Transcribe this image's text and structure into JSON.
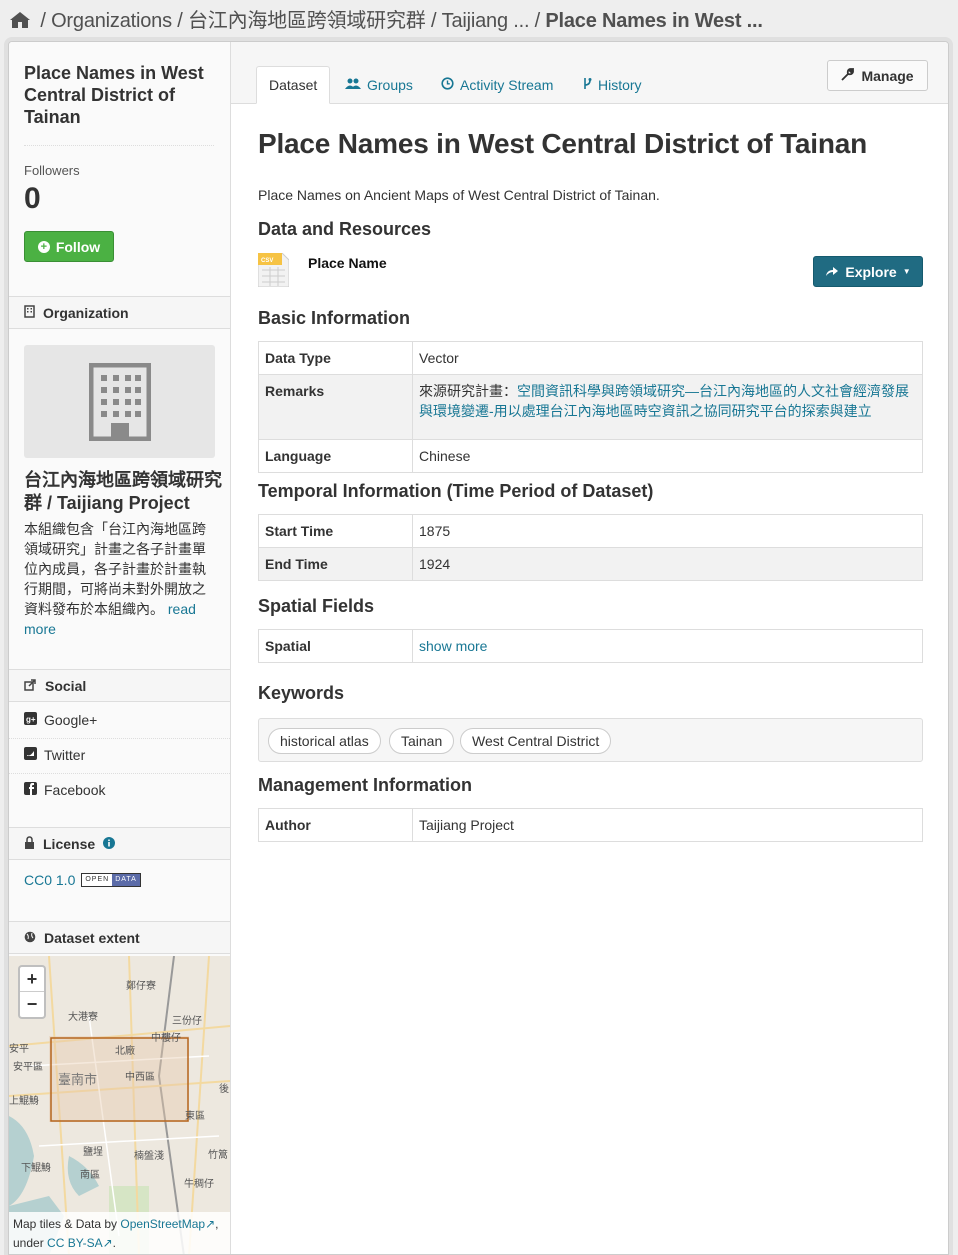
{
  "breadcrumb": {
    "home_icon": "home-icon",
    "sep": "/",
    "items": [
      "Organizations",
      "台江內海地區跨領域研究群",
      "Taijiang ...",
      "Place Names in West ..."
    ]
  },
  "sidebar": {
    "title": "Place Names in West Central District of Tainan",
    "followers_label": "Followers",
    "followers_count": "0",
    "follow_button": "Follow",
    "organization_heading": "Organization",
    "org_name": "台江內海地區跨領域研究群 / Taijiang Project",
    "org_description": "本組織包含「台江內海地區跨領域研究」計畫之各子計畫單位內成員，各子計畫於計畫執行期間，可將尚未對外開放之資料發布於本組織內。",
    "read_more": "read more",
    "social_heading": "Social",
    "social_items": [
      "Google+",
      "Twitter",
      "Facebook"
    ],
    "license_heading": "License",
    "license_link": "CC0 1.0",
    "open_data_badge": [
      "OPEN",
      "DATA"
    ],
    "extent_heading": "Dataset extent",
    "map": {
      "zoom_in": "+",
      "zoom_out": "−",
      "labels": [
        "鄭仔寮",
        "大港寮",
        "三份仔",
        "中樓仔",
        "安平",
        "北廠",
        "安平區",
        "臺南市",
        "中西區",
        "後",
        "上鯤鯓",
        "東區",
        "鹽埕",
        "竹篙",
        "楠盤淺",
        "下鯤鯓",
        "南區",
        "牛稠仔"
      ],
      "attribution_prefix": "Map tiles & Data by ",
      "attribution_osm": "OpenStreetMap",
      "attribution_mid": ",",
      "attribution_under": "under ",
      "attribution_license": "CC BY-SA",
      "attribution_end": "."
    }
  },
  "tabs": {
    "items": [
      {
        "label": "Dataset",
        "icon": ""
      },
      {
        "label": "Groups",
        "icon": "users-icon"
      },
      {
        "label": "Activity Stream",
        "icon": "clock-icon"
      },
      {
        "label": "History",
        "icon": "branch-icon"
      }
    ],
    "manage_button": "Manage"
  },
  "dataset": {
    "title": "Place Names in West Central District of Tainan",
    "notes": "Place Names on Ancient Maps of West Central District of Tainan.",
    "resources_heading": "Data and Resources",
    "resource": {
      "format": "CSV",
      "name": "Place Name"
    },
    "explore_button": "Explore",
    "basic_heading": "Basic Information",
    "basic_rows": {
      "data_type_label": "Data Type",
      "data_type_value": "Vector",
      "remarks_label": "Remarks",
      "remarks_prefix": "來源研究計畫：",
      "remarks_link": "空間資訊科學與跨領域研究—台江內海地區的人文社會經濟發展與環境變遷-用以處理台江內海地區時空資訊之協同研究平台的探索與建立",
      "language_label": "Language",
      "language_value": "Chinese"
    },
    "temporal_heading": "Temporal Information (Time Period of Dataset)",
    "temporal_rows": {
      "start_label": "Start Time",
      "start_value": "1875",
      "end_label": "End Time",
      "end_value": "1924"
    },
    "spatial_heading": "Spatial Fields",
    "spatial_label": "Spatial",
    "spatial_link": "show more",
    "keywords_heading": "Keywords",
    "keywords": [
      "historical atlas",
      "Tainan",
      "West Central District"
    ],
    "management_heading": "Management Information",
    "author_label": "Author",
    "author_value": "Taijiang Project"
  },
  "colors": {
    "link": "#187794",
    "follow_green": "#4bb143",
    "explore_blue": "#206b82"
  }
}
